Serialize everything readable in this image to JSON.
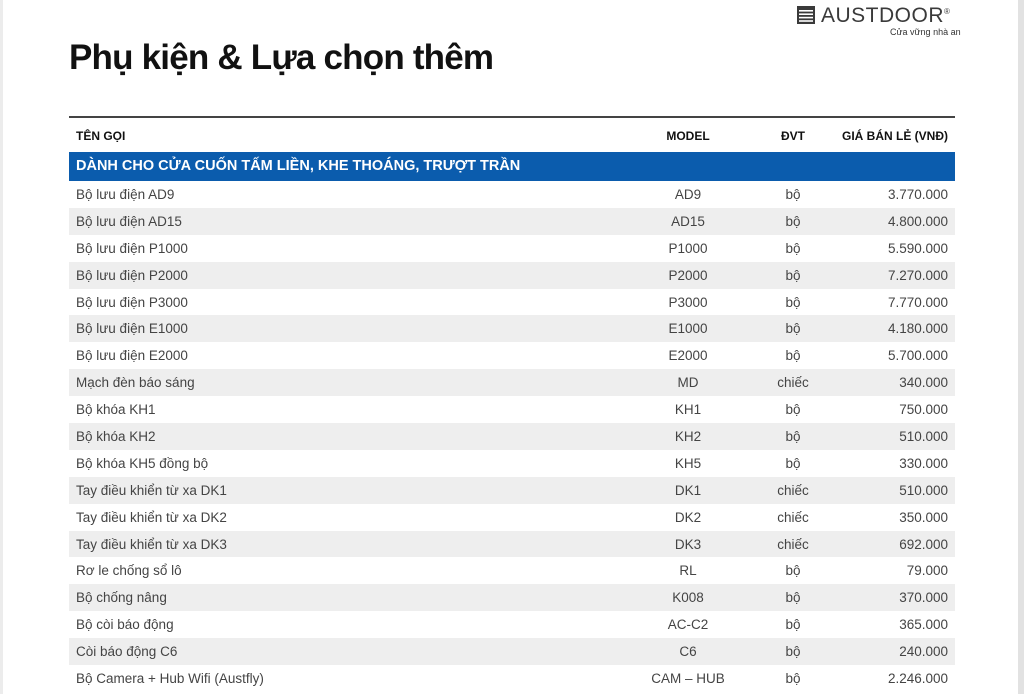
{
  "brand": {
    "name": "AUSTDOOR",
    "registered": "®",
    "tagline": "Cửa vững nhà an"
  },
  "title": "Phụ kiện & Lựa chọn thêm",
  "table": {
    "headers": {
      "name": "TÊN GỌI",
      "model": "MODEL",
      "unit": "ĐVT",
      "price": "GIÁ BÁN LẺ (VNĐ)"
    },
    "section": "DÀNH CHO CỬA CUỐN TẤM LIỀN, KHE THOÁNG, TRƯỢT TRẦN",
    "rows": [
      {
        "name": "Bộ lưu điện AD9",
        "model": "AD9",
        "unit": "bộ",
        "price": "3.770.000"
      },
      {
        "name": "Bộ lưu điện AD15",
        "model": "AD15",
        "unit": "bộ",
        "price": "4.800.000"
      },
      {
        "name": "Bộ lưu điện P1000",
        "model": "P1000",
        "unit": "bộ",
        "price": "5.590.000"
      },
      {
        "name": "Bộ lưu điện P2000",
        "model": "P2000",
        "unit": "bộ",
        "price": "7.270.000"
      },
      {
        "name": "Bộ lưu điện P3000",
        "model": "P3000",
        "unit": "bộ",
        "price": "7.770.000"
      },
      {
        "name": "Bộ lưu điện E1000",
        "model": "E1000",
        "unit": "bộ",
        "price": "4.180.000"
      },
      {
        "name": "Bộ lưu điện E2000",
        "model": "E2000",
        "unit": "bộ",
        "price": "5.700.000"
      },
      {
        "name": "Mạch đèn báo sáng",
        "model": "MD",
        "unit": "chiếc",
        "price": "340.000"
      },
      {
        "name": "Bộ khóa KH1",
        "model": "KH1",
        "unit": "bộ",
        "price": "750.000"
      },
      {
        "name": "Bộ khóa KH2",
        "model": "KH2",
        "unit": "bộ",
        "price": "510.000"
      },
      {
        "name": "Bộ khóa KH5 đồng bộ",
        "model": "KH5",
        "unit": "bộ",
        "price": "330.000"
      },
      {
        "name": "Tay điều khiển từ xa DK1",
        "model": "DK1",
        "unit": "chiếc",
        "price": "510.000"
      },
      {
        "name": "Tay điều khiển từ xa DK2",
        "model": "DK2",
        "unit": "chiếc",
        "price": "350.000"
      },
      {
        "name": "Tay điều khiển từ xa DK3",
        "model": "DK3",
        "unit": "chiếc",
        "price": "692.000"
      },
      {
        "name": "Rơ le chống sổ lô",
        "model": "RL",
        "unit": "bộ",
        "price": "79.000"
      },
      {
        "name": "Bộ chống nâng",
        "model": "K008",
        "unit": "bộ",
        "price": "370.000"
      },
      {
        "name": "Bộ còi báo động",
        "model": "AC-C2",
        "unit": "bộ",
        "price": "365.000"
      },
      {
        "name": "Còi báo động C6",
        "model": "C6",
        "unit": "bộ",
        "price": "240.000"
      },
      {
        "name": "Bộ Camera + Hub Wifi (Austfly)",
        "model": "CAM – HUB",
        "unit": "bộ",
        "price": "2.246.000"
      }
    ]
  }
}
